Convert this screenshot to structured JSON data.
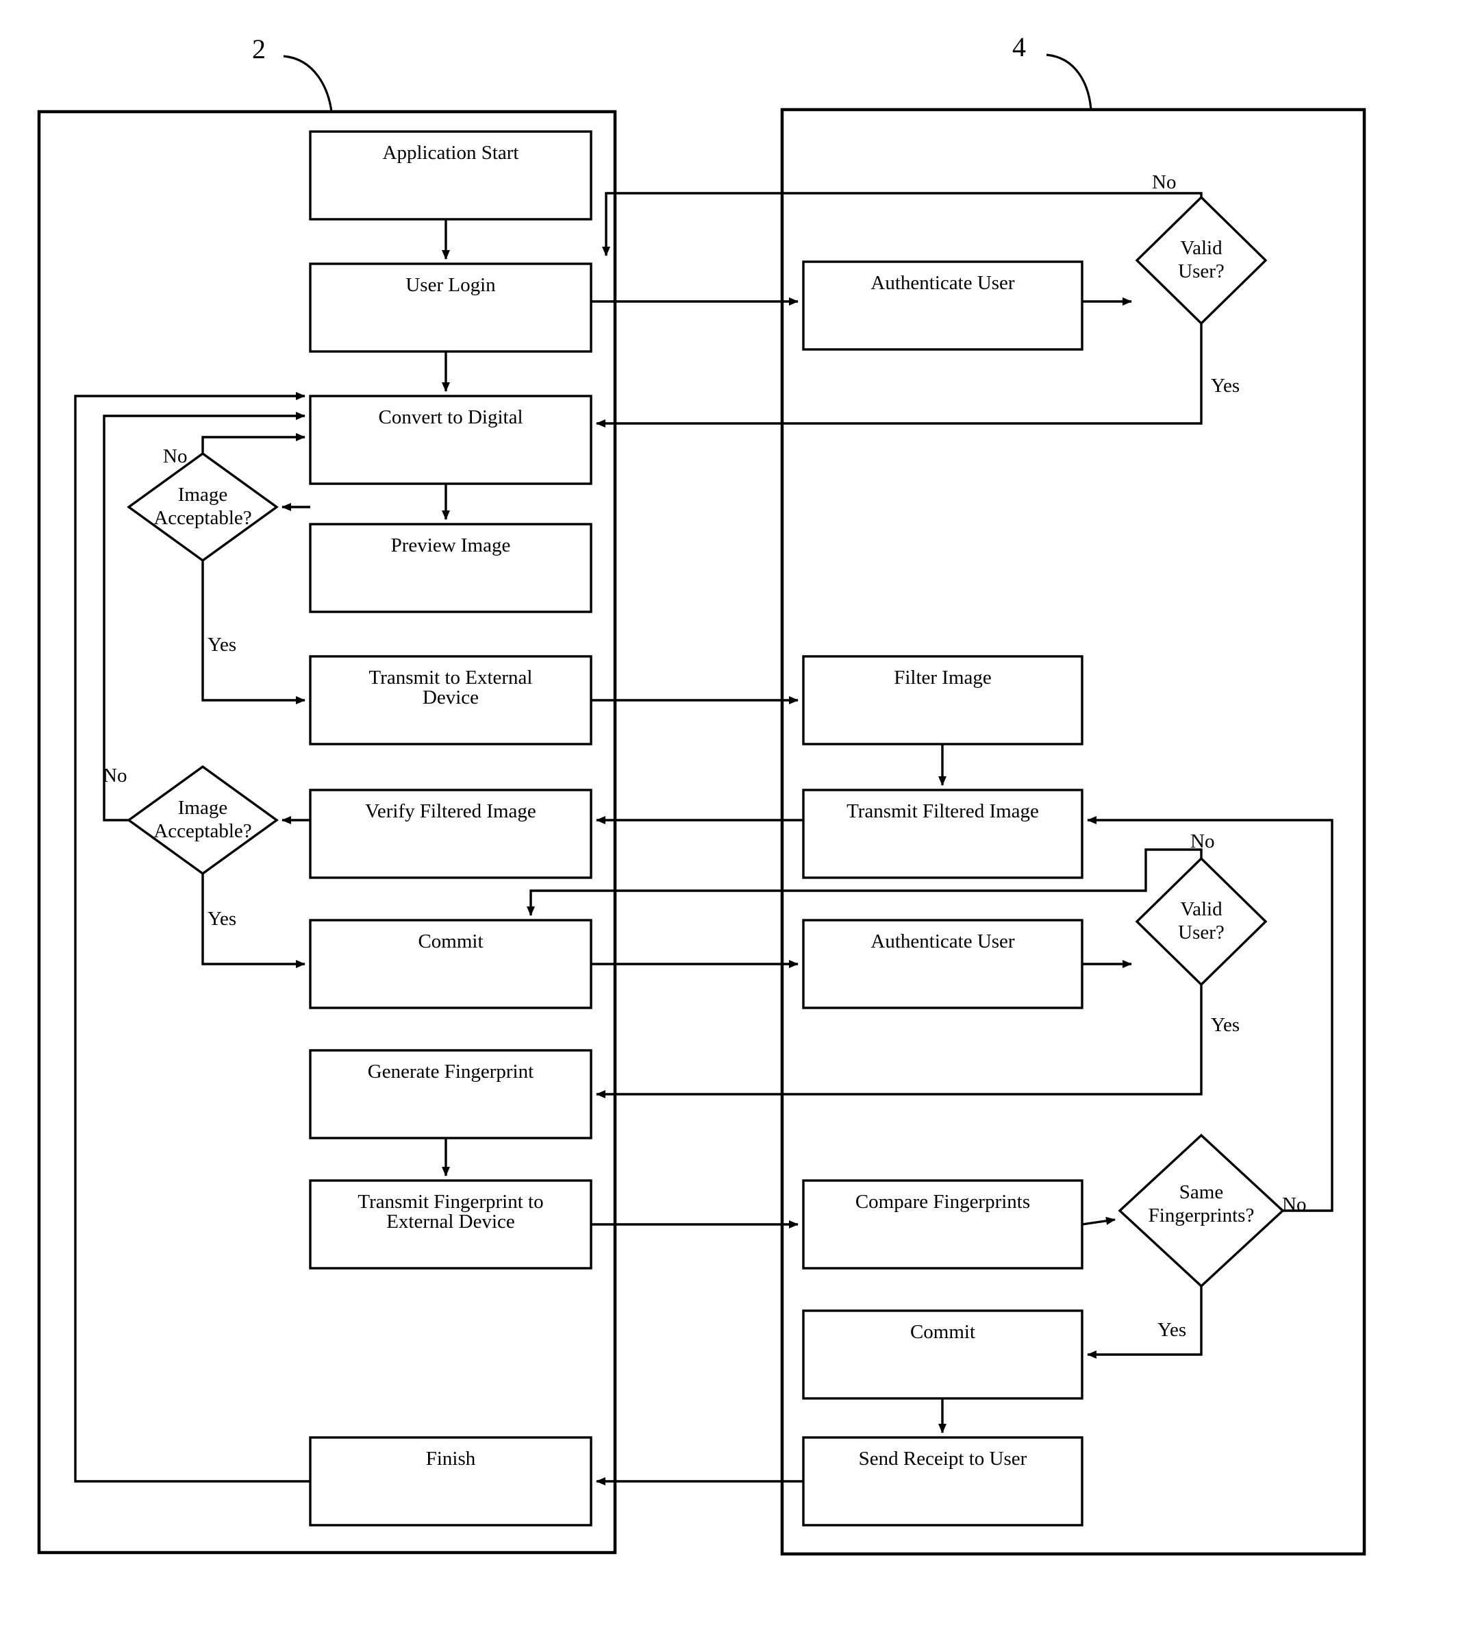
{
  "diagram": {
    "title_refs": [
      {
        "name": "client-side-ref",
        "text": "2"
      },
      {
        "name": "server-side-ref",
        "text": "4"
      }
    ],
    "containers": [
      {
        "name": "left-container",
        "ref": "2"
      },
      {
        "name": "right-container",
        "ref": "4"
      }
    ],
    "left_nodes": [
      {
        "id": "application-start",
        "label": "Application Start",
        "shape": "process"
      },
      {
        "id": "user-login",
        "label": "User Login",
        "shape": "process"
      },
      {
        "id": "convert-to-digital",
        "label": "Convert to Digital",
        "shape": "process"
      },
      {
        "id": "preview-image",
        "label": "Preview Image",
        "shape": "process"
      },
      {
        "id": "image-acceptable-1",
        "label": "Image\nAcceptable?",
        "shape": "decision"
      },
      {
        "id": "transmit-to-external-device",
        "label": "Transmit to External\nDevice",
        "shape": "process"
      },
      {
        "id": "verify-filtered-image",
        "label": "Verify Filtered Image",
        "shape": "process"
      },
      {
        "id": "image-acceptable-2",
        "label": "Image\nAcceptable?",
        "shape": "decision"
      },
      {
        "id": "commit-left",
        "label": "Commit",
        "shape": "process"
      },
      {
        "id": "generate-fingerprint",
        "label": "Generate Fingerprint",
        "shape": "process"
      },
      {
        "id": "transmit-fingerprint",
        "label": "Transmit Fingerprint to\nExternal Device",
        "shape": "process"
      },
      {
        "id": "finish",
        "label": "Finish",
        "shape": "process"
      }
    ],
    "right_nodes": [
      {
        "id": "authenticate-user-1",
        "label": "Authenticate User",
        "shape": "process"
      },
      {
        "id": "valid-user-1",
        "label": "Valid\nUser?",
        "shape": "decision"
      },
      {
        "id": "filter-image",
        "label": "Filter Image",
        "shape": "process"
      },
      {
        "id": "transmit-filtered-image",
        "label": "Transmit Filtered Image",
        "shape": "process"
      },
      {
        "id": "authenticate-user-2",
        "label": "Authenticate User",
        "shape": "process"
      },
      {
        "id": "valid-user-2",
        "label": "Valid\nUser?",
        "shape": "decision"
      },
      {
        "id": "compare-fingerprints",
        "label": "Compare Fingerprints",
        "shape": "process"
      },
      {
        "id": "same-fingerprints",
        "label": "Same\nFingerprints?",
        "shape": "decision"
      },
      {
        "id": "commit-right",
        "label": "Commit",
        "shape": "process"
      },
      {
        "id": "send-receipt-to-user",
        "label": "Send Receipt to User",
        "shape": "process"
      }
    ],
    "edge_labels": [
      {
        "id": "valid-user-1-no",
        "text": "No"
      },
      {
        "id": "valid-user-1-yes",
        "text": "Yes"
      },
      {
        "id": "image-acceptable-1-no",
        "text": "No"
      },
      {
        "id": "image-acceptable-1-yes",
        "text": "Yes"
      },
      {
        "id": "image-acceptable-2-no",
        "text": "No"
      },
      {
        "id": "image-acceptable-2-yes",
        "text": "Yes"
      },
      {
        "id": "valid-user-2-no",
        "text": "No"
      },
      {
        "id": "valid-user-2-yes",
        "text": "Yes"
      },
      {
        "id": "same-fingerprints-no",
        "text": "No"
      },
      {
        "id": "same-fingerprints-yes",
        "text": "Yes"
      }
    ],
    "node_labels": {
      "application_start": "Application Start",
      "user_login": "User Login",
      "convert_to_digital": "Convert to Digital",
      "preview_image": "Preview Image",
      "image_acceptable_1_l1": "Image",
      "image_acceptable_1_l2": "Acceptable?",
      "transmit_to_external_l1": "Transmit to External",
      "transmit_to_external_l2": "Device",
      "verify_filtered_image": "Verify Filtered Image",
      "image_acceptable_2_l1": "Image",
      "image_acceptable_2_l2": "Acceptable?",
      "commit_left": "Commit",
      "generate_fingerprint": "Generate Fingerprint",
      "transmit_fingerprint_l1": "Transmit Fingerprint to",
      "transmit_fingerprint_l2": "External Device",
      "finish": "Finish",
      "authenticate_user_1": "Authenticate User",
      "valid_user_1_l1": "Valid",
      "valid_user_1_l2": "User?",
      "filter_image": "Filter Image",
      "transmit_filtered_image": "Transmit Filtered Image",
      "authenticate_user_2": "Authenticate User",
      "valid_user_2_l1": "Valid",
      "valid_user_2_l2": "User?",
      "compare_fingerprints": "Compare Fingerprints",
      "same_fingerprints_l1": "Same",
      "same_fingerprints_l2": "Fingerprints?",
      "commit_right": "Commit",
      "send_receipt_to_user": "Send Receipt to User"
    },
    "labels": {
      "ref2": "2",
      "ref4": "4",
      "no": "No",
      "yes": "Yes"
    },
    "colors": {
      "stroke": "#000000",
      "fill": "#ffffff",
      "background": "#ffffff"
    }
  }
}
